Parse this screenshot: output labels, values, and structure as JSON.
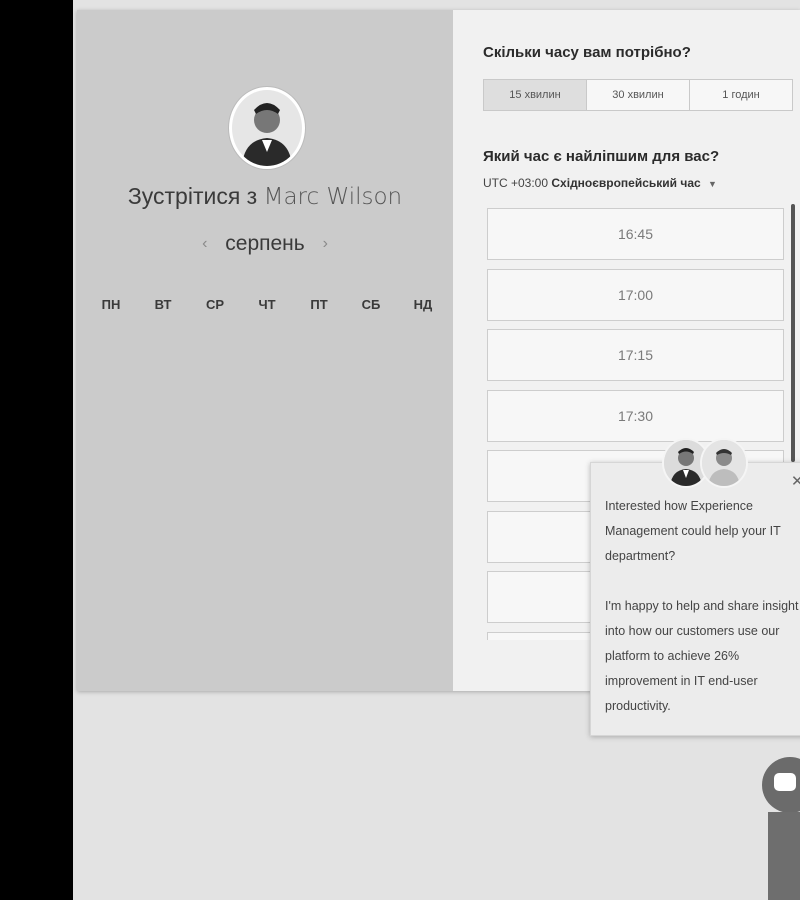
{
  "left": {
    "title_prefix": "Зустрітися з ",
    "host_name": "Marc Wilson",
    "month": "серпень",
    "weekdays": [
      "ПН",
      "ВТ",
      "СР",
      "ЧТ",
      "ПТ",
      "СБ",
      "НД"
    ]
  },
  "right": {
    "duration_question": "Скільки часу вам потрібно?",
    "durations": [
      {
        "label": "15 хвилин",
        "selected": true
      },
      {
        "label": "30 хвилин",
        "selected": false
      },
      {
        "label": "1 годин",
        "selected": false
      }
    ],
    "time_question": "Який час є найліпшим для вас?",
    "timezone_offset": "UTC +03:00",
    "timezone_name": "Східноєвропейський час",
    "slots": [
      "16:45",
      "17:00",
      "17:15",
      "17:30",
      "",
      "",
      "",
      ""
    ]
  },
  "chat": {
    "message_1": "Interested how Experience Management could help your IT department?",
    "message_2": "I'm happy to help and share insight into how our customers use our platform to achieve 26% improvement in IT end-user productivity."
  },
  "icons": {
    "prev": "chevron-left-icon",
    "next": "chevron-right-icon",
    "timezone_caret": "caret-down-icon",
    "close": "close-icon",
    "chat_launcher": "chat-bubble-icon"
  }
}
